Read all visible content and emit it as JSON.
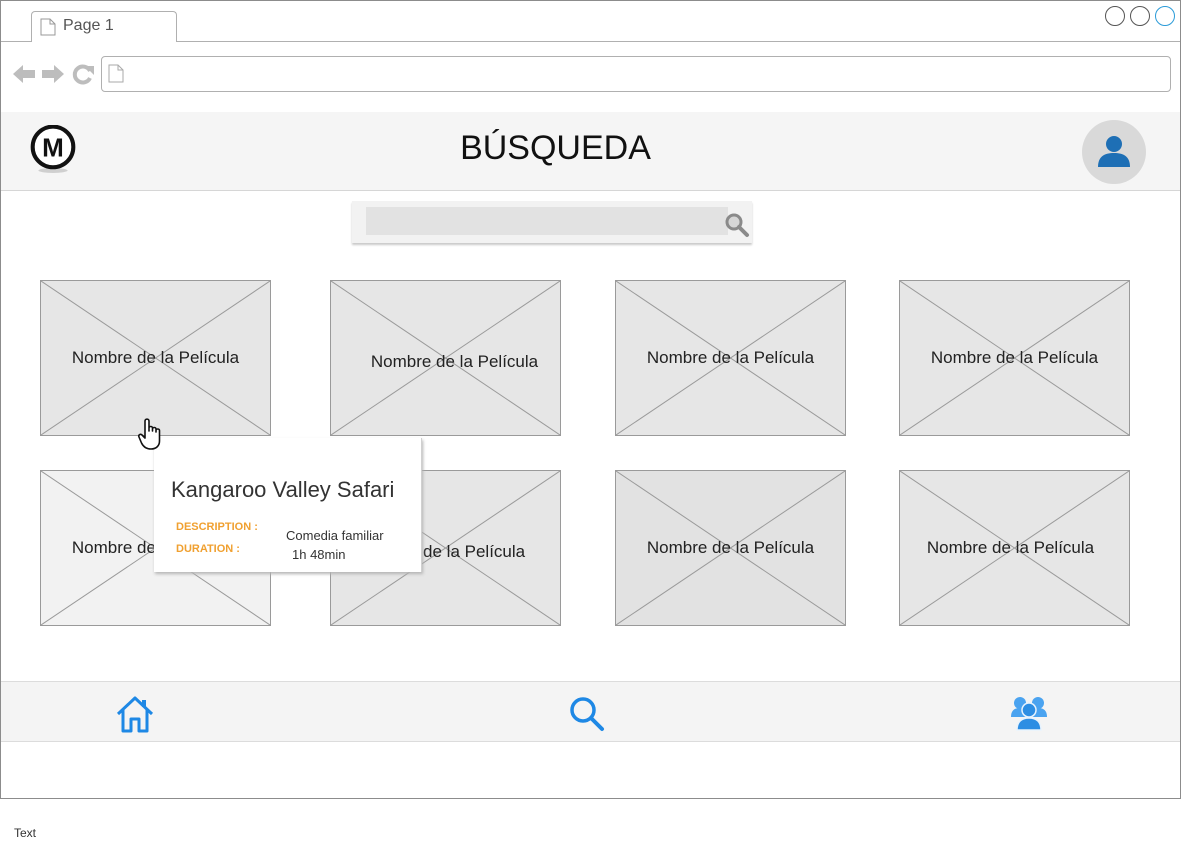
{
  "browser": {
    "tab_label": "Page 1",
    "address_value": ""
  },
  "header": {
    "title": "BÚSQUEDA",
    "logo_letter": "M"
  },
  "search": {
    "value": "",
    "placeholder": ""
  },
  "movies": [
    {
      "label": "Nombre de la Película"
    },
    {
      "label": "Nombre de la Película"
    },
    {
      "label": "Nombre de la Película"
    },
    {
      "label": "Nombre de la Película"
    },
    {
      "label": "Nombre de la Película"
    },
    {
      "label": "Nombre de la Película"
    },
    {
      "label": "Nombre de la Película"
    },
    {
      "label": "Nombre de la Película"
    }
  ],
  "tooltip": {
    "title": "Kangaroo Valley Safari",
    "description_label": "DESCRIPTION :",
    "description_value": "Comedia familiar",
    "duration_label": "DURATION :",
    "duration_value": "1h 48min"
  },
  "bottom_nav": {
    "icons": [
      "home-icon",
      "search-icon",
      "community-icon"
    ]
  },
  "footer_text": "Text",
  "colors": {
    "accent_blue": "#1e88e5",
    "tooltip_key": "#f0a030",
    "header_bg": "#f5f5f5"
  }
}
